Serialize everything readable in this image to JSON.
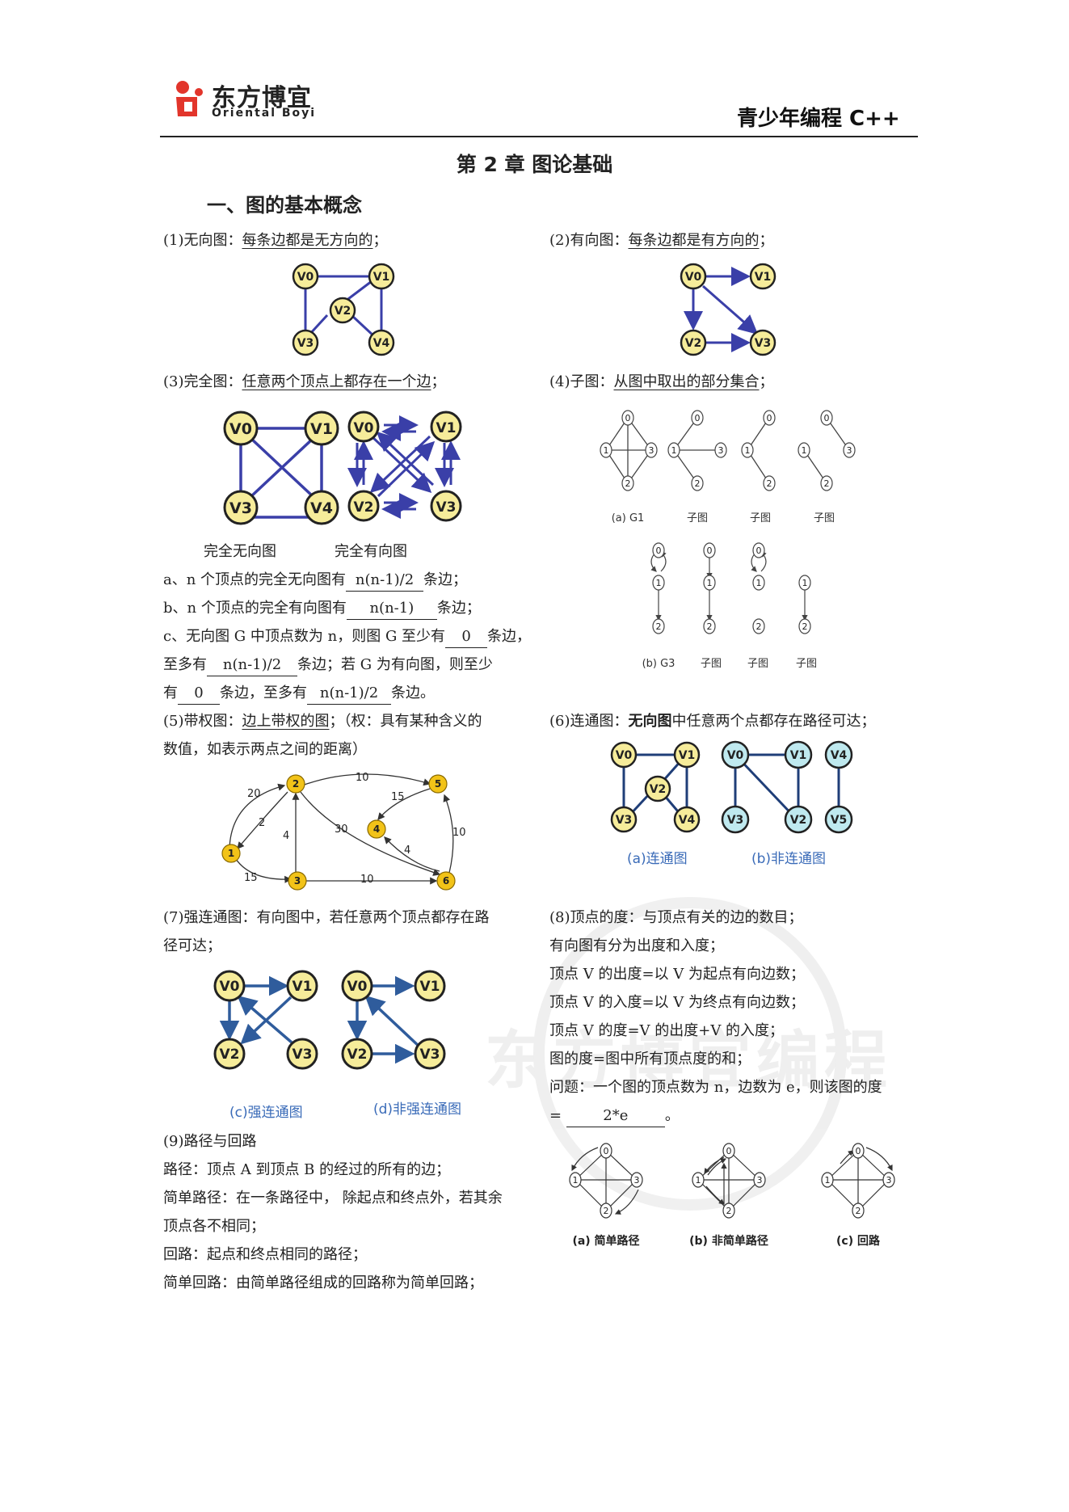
{
  "header": {
    "logo_cn": "东方博宜",
    "logo_en": "Oriental Boyi",
    "right_title": "青少年编程 C++"
  },
  "chapter_title": "第 2 章  图论基础",
  "section_title": "一、图的基本概念",
  "items": {
    "i1": {
      "label": "(1)无向图：",
      "def": "每条边都是无方向的",
      "tail": "；"
    },
    "i2": {
      "label": "(2)有向图：",
      "def": "每条边都是有方向的",
      "tail": "；"
    },
    "i3": {
      "label": "(3)完全图：",
      "def": "任意两个顶点上都存在一个边",
      "tail": "；"
    },
    "i4": {
      "label": "(4)子图：",
      "def": "从图中取出的部分集合",
      "tail": "；"
    },
    "complete_caps": [
      "完全无向图",
      "完全有向图"
    ],
    "qa": {
      "a_pre": "a、n 个顶点的完全无向图有",
      "a_blank": "n(n-1)/2",
      "a_post": "条边；",
      "b_pre": "b、n 个顶点的完全有向图有",
      "b_blank": "n(n-1)",
      "b_post": "条边；",
      "c1_pre": "c、无向图 G 中顶点数为 n，则图 G 至少有",
      "c1_blank": "0",
      "c1_post": "条边，",
      "c2_pre": "至多有",
      "c2_blank": "n(n-1)/2",
      "c2_post": "条边；若 G 为有向图，则至少",
      "c3_pre": "有",
      "c3_blank": "0",
      "c3_mid": "条边，至多有",
      "c3_blank2": "n(n-1)/2",
      "c3_post": "条边。"
    },
    "i5": {
      "label": "(5)带权图：",
      "def": "边上带权的图",
      "rest1": "；（权：具有某种含义的",
      "rest2": "数值，如表示两点之间的距离）"
    },
    "i6": {
      "label": "(6)连通图：",
      "bold": "无向图",
      "rest": "中任意两个点都存在路径可达；"
    },
    "i7": {
      "line1": "(7)强连通图：有向图中，若任意两个顶点都存在路",
      "line2": "径可达；"
    },
    "i8": {
      "lines": [
        "(8)顶点的度：与顶点有关的边的数目；",
        "有向图有分为出度和入度；",
        "顶点 V 的出度=以 V 为起点有向边数；",
        "顶点 V 的入度=以 V 为终点有向边数；",
        "顶点 V 的度=V 的出度+V 的入度；",
        "图的度=图中所有顶点度的和；",
        "问题：一个图的顶点数为 n，边数为 e，则该图的度"
      ],
      "answer_pre": "=",
      "answer": "2*e",
      "answer_post": "。"
    },
    "i9": {
      "lines": [
        "(9)路径与回路",
        "路径：顶点 A 到顶点 B 的经过的所有的边；",
        "简单路径：在一条路径中， 除起点和终点外，若其余",
        "顶点各不相同；",
        "回路：起点和终点相同的路径；",
        "简单回路：由简单路径组成的回路称为简单回路；"
      ]
    }
  },
  "figures": {
    "subgraph_caps_top": [
      "(a) G1",
      "子图",
      "子图",
      "子图"
    ],
    "subgraph_caps_bottom": [
      "(b) G3",
      "子图",
      "子图",
      "子图"
    ],
    "connected_caps": [
      "(a)连通图",
      "(b)非连通图"
    ],
    "strong_caps": [
      "(c)强连通图",
      "(d)非强连通图"
    ],
    "path_caps": [
      "(a) 简单路径",
      "(b) 非简单路径",
      "(c) 回路"
    ],
    "weighted": {
      "nodes": [
        "1",
        "2",
        "3",
        "4",
        "5",
        "6"
      ],
      "weights": [
        "20",
        "2",
        "15",
        "4",
        "10",
        "15",
        "30",
        "10",
        "4",
        "10"
      ]
    },
    "vertex_labels": [
      "V0",
      "V1",
      "V2",
      "V3",
      "V4",
      "V5"
    ],
    "small_labels": [
      "0",
      "1",
      "2",
      "3"
    ],
    "colors": {
      "node_fill": "#f6ec9a",
      "edge": "#3a3fa8",
      "weighted_fill": "#f2c318",
      "cyan_fill": "#bfe9ef",
      "caption_blue": "#3a6bb8",
      "strong_edge": "#2f5c9c"
    }
  },
  "watermark": "东方博宜编程"
}
